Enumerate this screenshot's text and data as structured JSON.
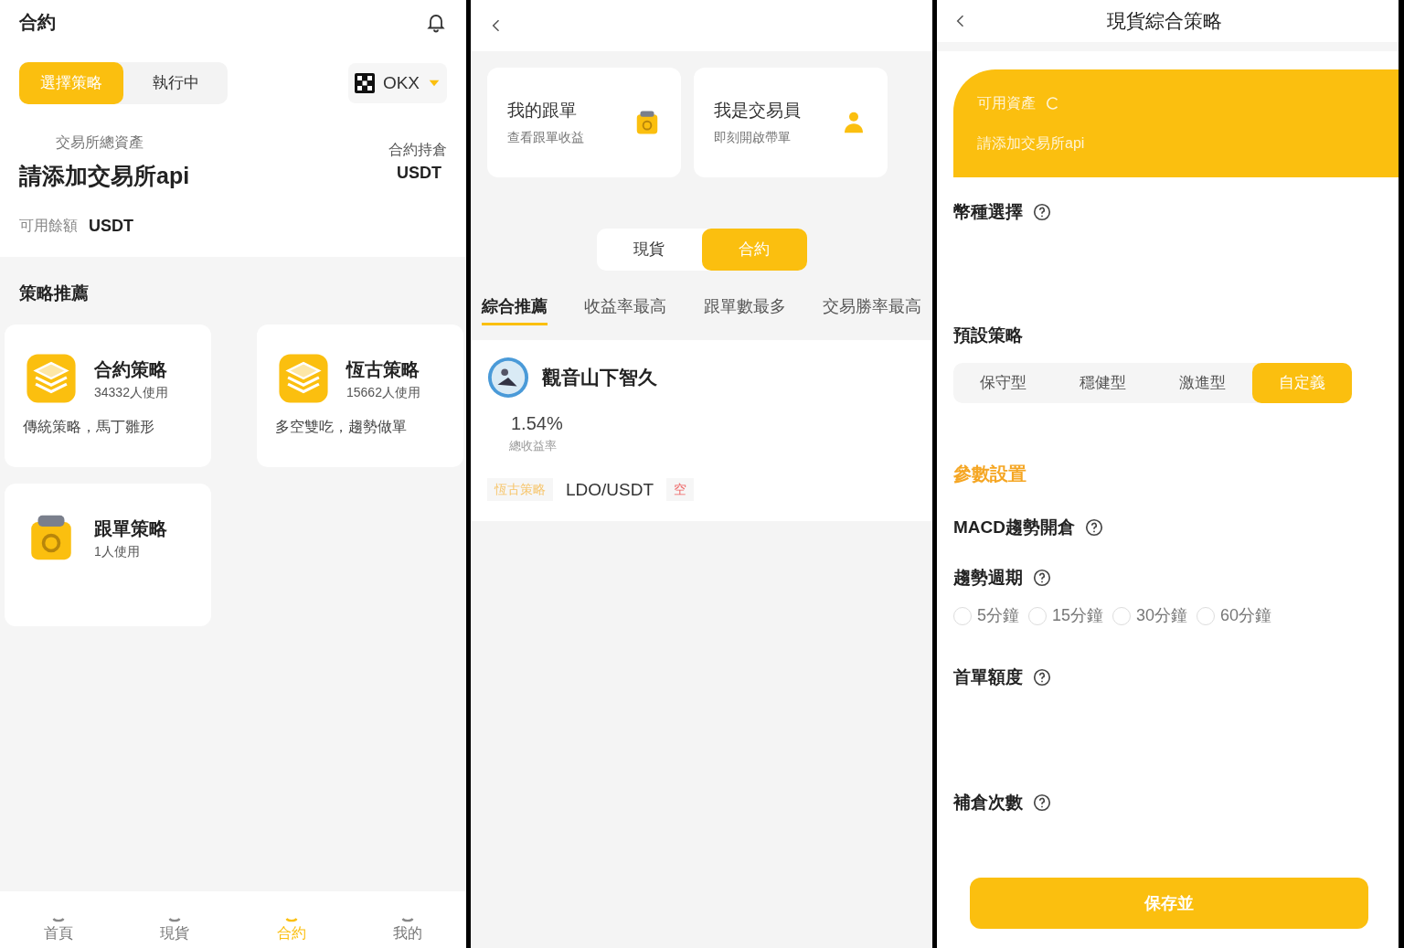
{
  "contract_screen": {
    "title": "合約",
    "mode_tabs": [
      {
        "label": "選擇策略",
        "selected": true
      },
      {
        "label": "執行中",
        "selected": false
      }
    ],
    "exchange": "OKX",
    "assets_label": "交易所總資產",
    "assets_value": "請添加交易所api",
    "position_label": "合約持倉",
    "position_unit": "USDT",
    "balance_label": "可用餘額",
    "balance_unit": "USDT",
    "section_title": "策略推薦",
    "strategies": [
      {
        "name": "合約策略",
        "users": "34332人使用",
        "description": "傳統策略，馬丁雛形",
        "kind": "layers"
      },
      {
        "name": "恆古策略",
        "users": "15662人使用",
        "description": "多空雙吃，趨勢做單",
        "kind": "layers"
      },
      {
        "name": "跟單策略",
        "users": "1人使用",
        "kind": "wallet"
      }
    ],
    "nav": [
      {
        "label": "首頁",
        "selected": false
      },
      {
        "label": "現貨",
        "selected": false
      },
      {
        "label": "合約",
        "selected": true
      },
      {
        "label": "我的",
        "selected": false
      }
    ]
  },
  "copy_screen": {
    "cards": [
      {
        "title": "我的跟單",
        "subtitle": "查看跟單收益",
        "kind": "wallet"
      },
      {
        "title": "我是交易員",
        "subtitle": "即刻開啟帶單",
        "kind": "person"
      }
    ],
    "market_tabs": [
      {
        "label": "現貨",
        "selected": false
      },
      {
        "label": "合約",
        "selected": true
      }
    ],
    "sort_tabs": [
      {
        "label": "綜合推薦",
        "selected": true
      },
      {
        "label": "收益率最高",
        "selected": false
      },
      {
        "label": "跟單數最多",
        "selected": false
      },
      {
        "label": "交易勝率最高",
        "selected": false
      }
    ],
    "trader": {
      "name": "觀音山下智久",
      "return": "1.54%",
      "return_label": "總收益率",
      "tags": [
        {
          "text": "恆古策略",
          "kind": "strategy"
        },
        {
          "text": "LDO/USDT",
          "kind": "pair"
        },
        {
          "text": "空",
          "kind": "short"
        }
      ]
    }
  },
  "spot_screen": {
    "title": "現貨綜合策略",
    "banner_label": "可用資產",
    "banner_value": "請添加交易所api",
    "coin_label": "幣種選擇",
    "preset_label": "預設策略",
    "presets": [
      {
        "label": "保守型",
        "selected": false
      },
      {
        "label": "穩健型",
        "selected": false
      },
      {
        "label": "激進型",
        "selected": false
      },
      {
        "label": "自定義",
        "selected": true
      }
    ],
    "params_title": "參數設置",
    "macd_label": "MACD趨勢開倉",
    "period_label": "趨勢週期",
    "periods": [
      {
        "label": "5分鐘",
        "selected": false
      },
      {
        "label": "15分鐘",
        "selected": false
      },
      {
        "label": "30分鐘",
        "selected": false
      },
      {
        "label": "60分鐘",
        "selected": false
      }
    ],
    "first_amount_label": "首單額度",
    "add_count_label": "補倉次數",
    "save_button": "保存並"
  }
}
